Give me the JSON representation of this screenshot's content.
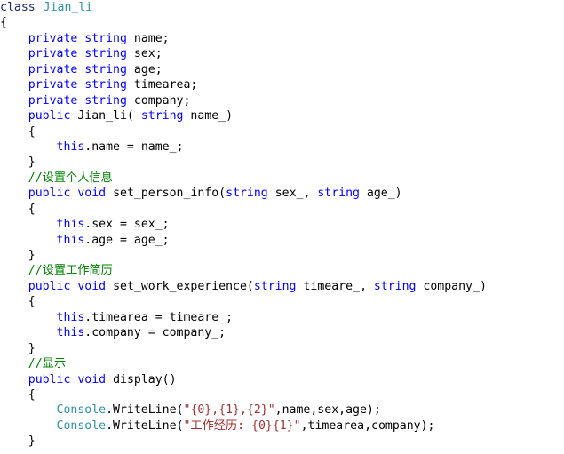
{
  "editor": {
    "language": "C#",
    "background_color": "#ffffff",
    "colors": {
      "keyword": "#0000ff",
      "type": "#2b91af",
      "comment": "#008000",
      "string": "#a03030",
      "identifier": "#000000",
      "caret": "#000000"
    },
    "caret_after_text": "class",
    "lines": [
      {
        "indent": 0,
        "tokens": [
          {
            "t": "class",
            "c": "cls"
          },
          {
            "t": "caret",
            "c": "caret"
          },
          {
            "t": " ",
            "c": "id"
          },
          {
            "t": "Jian_li",
            "c": "type"
          }
        ]
      },
      {
        "indent": 0,
        "tokens": [
          {
            "t": "{",
            "c": "punc"
          }
        ]
      },
      {
        "indent": 1,
        "tokens": [
          {
            "t": "private",
            "c": "kw"
          },
          {
            "t": " ",
            "c": "id"
          },
          {
            "t": "string",
            "c": "kw"
          },
          {
            "t": " name;",
            "c": "id"
          }
        ]
      },
      {
        "indent": 1,
        "tokens": [
          {
            "t": "private",
            "c": "kw"
          },
          {
            "t": " ",
            "c": "id"
          },
          {
            "t": "string",
            "c": "kw"
          },
          {
            "t": " sex;",
            "c": "id"
          }
        ]
      },
      {
        "indent": 1,
        "tokens": [
          {
            "t": "private",
            "c": "kw"
          },
          {
            "t": " ",
            "c": "id"
          },
          {
            "t": "string",
            "c": "kw"
          },
          {
            "t": " age;",
            "c": "id"
          }
        ]
      },
      {
        "indent": 1,
        "tokens": [
          {
            "t": "private",
            "c": "kw"
          },
          {
            "t": " ",
            "c": "id"
          },
          {
            "t": "string",
            "c": "kw"
          },
          {
            "t": " timearea;",
            "c": "id"
          }
        ]
      },
      {
        "indent": 1,
        "tokens": [
          {
            "t": "private",
            "c": "kw"
          },
          {
            "t": " ",
            "c": "id"
          },
          {
            "t": "string",
            "c": "kw"
          },
          {
            "t": " company;",
            "c": "id"
          }
        ]
      },
      {
        "indent": 1,
        "tokens": [
          {
            "t": "public",
            "c": "kw"
          },
          {
            "t": " Jian_li( ",
            "c": "id"
          },
          {
            "t": "string",
            "c": "kw"
          },
          {
            "t": " name_)",
            "c": "id"
          }
        ]
      },
      {
        "indent": 1,
        "tokens": [
          {
            "t": "{",
            "c": "punc"
          }
        ]
      },
      {
        "indent": 2,
        "tokens": [
          {
            "t": "this",
            "c": "kw"
          },
          {
            "t": ".name = name_;",
            "c": "id"
          }
        ]
      },
      {
        "indent": 1,
        "tokens": [
          {
            "t": "}",
            "c": "punc"
          }
        ]
      },
      {
        "indent": 1,
        "tokens": [
          {
            "t": "//设置个人信息",
            "c": "cmt"
          }
        ]
      },
      {
        "indent": 1,
        "tokens": [
          {
            "t": "public",
            "c": "kw"
          },
          {
            "t": " ",
            "c": "id"
          },
          {
            "t": "void",
            "c": "kw"
          },
          {
            "t": " set_person_info(",
            "c": "id"
          },
          {
            "t": "string",
            "c": "kw"
          },
          {
            "t": " sex_, ",
            "c": "id"
          },
          {
            "t": "string",
            "c": "kw"
          },
          {
            "t": " age_)",
            "c": "id"
          }
        ]
      },
      {
        "indent": 1,
        "tokens": [
          {
            "t": "{",
            "c": "punc"
          }
        ]
      },
      {
        "indent": 2,
        "tokens": [
          {
            "t": "this",
            "c": "kw"
          },
          {
            "t": ".sex = sex_;",
            "c": "id"
          }
        ]
      },
      {
        "indent": 2,
        "tokens": [
          {
            "t": "this",
            "c": "kw"
          },
          {
            "t": ".age = age_;",
            "c": "id"
          }
        ]
      },
      {
        "indent": 1,
        "tokens": [
          {
            "t": "}",
            "c": "punc"
          }
        ]
      },
      {
        "indent": 1,
        "tokens": [
          {
            "t": "//设置工作简历",
            "c": "cmt"
          }
        ]
      },
      {
        "indent": 1,
        "tokens": [
          {
            "t": "public",
            "c": "kw"
          },
          {
            "t": " ",
            "c": "id"
          },
          {
            "t": "void",
            "c": "kw"
          },
          {
            "t": " set_work_experience(",
            "c": "id"
          },
          {
            "t": "string",
            "c": "kw"
          },
          {
            "t": " timeare_, ",
            "c": "id"
          },
          {
            "t": "string",
            "c": "kw"
          },
          {
            "t": " company_)",
            "c": "id"
          }
        ]
      },
      {
        "indent": 1,
        "tokens": [
          {
            "t": "{",
            "c": "punc"
          }
        ]
      },
      {
        "indent": 2,
        "tokens": [
          {
            "t": "this",
            "c": "kw"
          },
          {
            "t": ".timearea = timeare_;",
            "c": "id"
          }
        ]
      },
      {
        "indent": 2,
        "tokens": [
          {
            "t": "this",
            "c": "kw"
          },
          {
            "t": ".company = company_;",
            "c": "id"
          }
        ]
      },
      {
        "indent": 1,
        "tokens": [
          {
            "t": "}",
            "c": "punc"
          }
        ]
      },
      {
        "indent": 1,
        "tokens": [
          {
            "t": "//显示",
            "c": "cmt"
          }
        ]
      },
      {
        "indent": 1,
        "tokens": [
          {
            "t": "public",
            "c": "kw"
          },
          {
            "t": " ",
            "c": "id"
          },
          {
            "t": "void",
            "c": "kw"
          },
          {
            "t": " display()",
            "c": "id"
          }
        ]
      },
      {
        "indent": 1,
        "tokens": [
          {
            "t": "{",
            "c": "punc"
          }
        ]
      },
      {
        "indent": 2,
        "tokens": [
          {
            "t": "Console",
            "c": "type"
          },
          {
            "t": ".WriteLine(",
            "c": "id"
          },
          {
            "t": "\"{0},{1},{2}\"",
            "c": "str"
          },
          {
            "t": ",name,sex,age);",
            "c": "id"
          }
        ]
      },
      {
        "indent": 2,
        "tokens": [
          {
            "t": "Console",
            "c": "type"
          },
          {
            "t": ".WriteLine(",
            "c": "id"
          },
          {
            "t": "\"工作经历: {0}{1}\"",
            "c": "str"
          },
          {
            "t": ",timearea,company);",
            "c": "id"
          }
        ]
      },
      {
        "indent": 1,
        "tokens": [
          {
            "t": "}",
            "c": "punc"
          }
        ]
      }
    ]
  }
}
